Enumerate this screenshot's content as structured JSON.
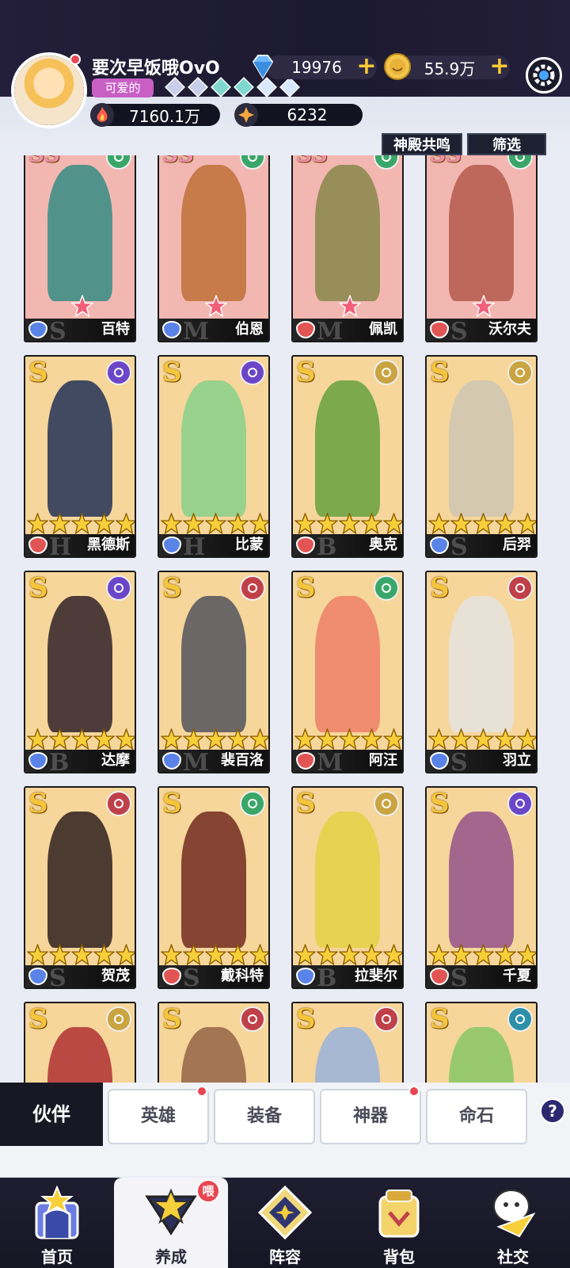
{
  "player": {
    "name": "要次早饭哦OvO",
    "title_badge": "可爱的",
    "rank_gems": 6
  },
  "currencies": {
    "diamonds": "19976",
    "gold": "55.9万",
    "power": "7160.1万",
    "stars": "6232"
  },
  "filters": {
    "resonance": "神殿共鸣",
    "filter": "筛选"
  },
  "heroes": [
    {
      "name": "百特",
      "rank": "SS",
      "cls_color": "#5a83e8",
      "elem": "green",
      "stars": 0,
      "pink": true,
      "bg": "#f3b7b2",
      "fig": "#3f8f86",
      "letter": "S"
    },
    {
      "name": "伯恩",
      "rank": "SS",
      "cls_color": "#5a83e8",
      "elem": "green",
      "stars": 0,
      "pink": true,
      "bg": "#f3b7b2",
      "fig": "#c2733e",
      "letter": "M"
    },
    {
      "name": "佩凯",
      "rank": "SS",
      "cls_color": "#e25555",
      "elem": "green",
      "stars": 0,
      "pink": true,
      "bg": "#f3b7b2",
      "fig": "#8e8a50",
      "letter": "M"
    },
    {
      "name": "沃尔夫",
      "rank": "SS",
      "cls_color": "#e25555",
      "elem": "green",
      "stars": 0,
      "pink": true,
      "bg": "#f3b7b2",
      "fig": "#b75f50",
      "letter": "S"
    },
    {
      "name": "黑德斯",
      "rank": "S",
      "cls_color": "#e25555",
      "elem": "purple",
      "stars": 5,
      "pink": false,
      "bg": "#f6d69b",
      "fig": "#2e3b5a",
      "letter": "H"
    },
    {
      "name": "比蒙",
      "rank": "S",
      "cls_color": "#5a83e8",
      "elem": "purple",
      "stars": 5,
      "pink": false,
      "bg": "#f6d69b",
      "fig": "#8fd18b",
      "letter": "H"
    },
    {
      "name": "奥克",
      "rank": "S",
      "cls_color": "#e25555",
      "elem": "gold",
      "stars": 5,
      "pink": false,
      "bg": "#f6d69b",
      "fig": "#6ea444",
      "letter": "B"
    },
    {
      "name": "后羿",
      "rank": "S",
      "cls_color": "#5a83e8",
      "elem": "gold",
      "stars": 5,
      "pink": false,
      "bg": "#f6d69b",
      "fig": "#d2c6b4",
      "letter": "S"
    },
    {
      "name": "达摩",
      "rank": "S",
      "cls_color": "#5a83e8",
      "elem": "purple",
      "stars": 5,
      "pink": false,
      "bg": "#f6d69b",
      "fig": "#3b2b2f",
      "letter": "B"
    },
    {
      "name": "裴百洛",
      "rank": "S",
      "cls_color": "#5a83e8",
      "elem": "red",
      "stars": 5,
      "pink": false,
      "bg": "#f6d69b",
      "fig": "#5b5b60",
      "letter": "M"
    },
    {
      "name": "阿汪",
      "rank": "S",
      "cls_color": "#e25555",
      "elem": "green",
      "stars": 5,
      "pink": false,
      "bg": "#f6d69b",
      "fig": "#f0846a",
      "letter": "M"
    },
    {
      "name": "羽立",
      "rank": "S",
      "cls_color": "#5a83e8",
      "elem": "red",
      "stars": 5,
      "pink": false,
      "bg": "#f6d69b",
      "fig": "#e7e2dc",
      "letter": "S"
    },
    {
      "name": "贺茂",
      "rank": "S",
      "cls_color": "#5a83e8",
      "elem": "red",
      "stars": 5,
      "pink": false,
      "bg": "#f6d69b",
      "fig": "#3a2a26",
      "letter": "S"
    },
    {
      "name": "戴科特",
      "rank": "S",
      "cls_color": "#e25555",
      "elem": "green",
      "stars": 5,
      "pink": false,
      "bg": "#f6d69b",
      "fig": "#7a3427",
      "letter": "S"
    },
    {
      "name": "拉斐尔",
      "rank": "S",
      "cls_color": "#5a83e8",
      "elem": "gold",
      "stars": 5,
      "pink": false,
      "bg": "#f6d69b",
      "fig": "#e6d24a",
      "letter": "B"
    },
    {
      "name": "千夏",
      "rank": "S",
      "cls_color": "#e25555",
      "elem": "purple",
      "stars": 5,
      "pink": false,
      "bg": "#f6d69b",
      "fig": "#9a5a8c",
      "letter": "S"
    },
    {
      "name": "",
      "rank": "S",
      "cls_color": "#e25555",
      "elem": "gold",
      "stars": 0,
      "pink": false,
      "bg": "#f6d69b",
      "fig": "#b53a3a",
      "letter": ""
    },
    {
      "name": "",
      "rank": "S",
      "cls_color": "#e25555",
      "elem": "red",
      "stars": 0,
      "pink": false,
      "bg": "#f6d69b",
      "fig": "#9a6a4a",
      "letter": ""
    },
    {
      "name": "",
      "rank": "S",
      "cls_color": "#e25555",
      "elem": "red",
      "stars": 0,
      "pink": false,
      "bg": "#f6d69b",
      "fig": "#9fb5d8",
      "letter": ""
    },
    {
      "name": "",
      "rank": "S",
      "cls_color": "#e25555",
      "elem": "teal",
      "stars": 0,
      "pink": false,
      "bg": "#f6d69b",
      "fig": "#8fc86a",
      "letter": ""
    }
  ],
  "tabs": [
    {
      "label": "伙伴",
      "active": true,
      "dot": false
    },
    {
      "label": "英雄",
      "active": false,
      "dot": true
    },
    {
      "label": "装备",
      "active": false,
      "dot": false
    },
    {
      "label": "神器",
      "active": false,
      "dot": true
    },
    {
      "label": "命石",
      "active": false,
      "dot": false
    }
  ],
  "help_label": "?",
  "nav": [
    {
      "label": "首页",
      "icon": "home-icon",
      "active": false
    },
    {
      "label": "养成",
      "icon": "star-upgrade-icon",
      "active": true,
      "badge": "喂"
    },
    {
      "label": "阵容",
      "icon": "formation-icon",
      "active": false
    },
    {
      "label": "背包",
      "icon": "backpack-icon",
      "active": false
    },
    {
      "label": "社交",
      "icon": "social-icon",
      "active": false
    }
  ],
  "colors": {
    "gold": "#f5c63c",
    "elem_green": "#3aa769",
    "elem_purple": "#6b46c8",
    "elem_gold": "#c9a441",
    "elem_red": "#c0404a",
    "elem_teal": "#2e8fa8"
  }
}
